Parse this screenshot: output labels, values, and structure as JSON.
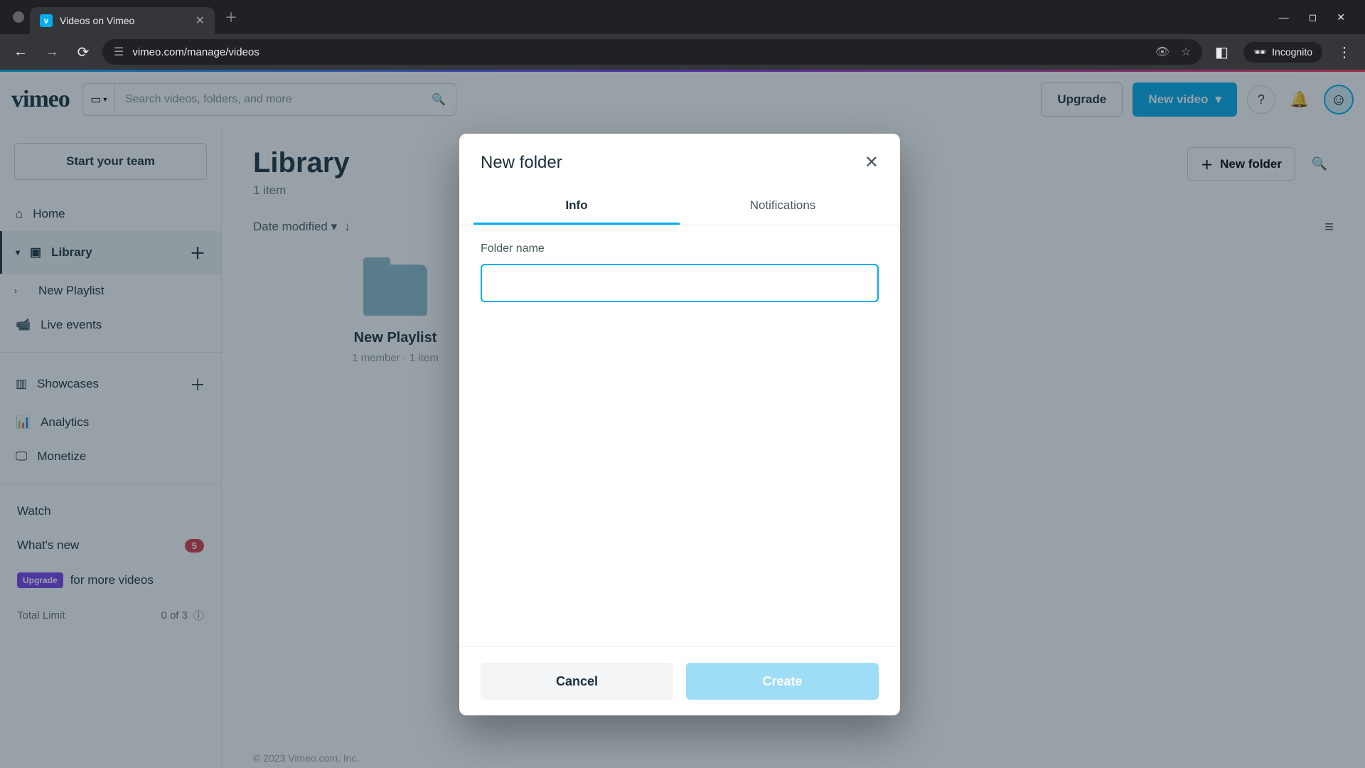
{
  "browser": {
    "tab_title": "Videos on Vimeo",
    "url": "vimeo.com/manage/videos",
    "incognito_label": "Incognito"
  },
  "topbar": {
    "logo": "vimeo",
    "search_placeholder": "Search videos, folders, and more",
    "upgrade": "Upgrade",
    "new_video": "New video"
  },
  "sidebar": {
    "start_team": "Start your team",
    "home": "Home",
    "library": "Library",
    "new_playlist": "New Playlist",
    "live_events": "Live events",
    "showcases": "Showcases",
    "analytics": "Analytics",
    "monetize": "Monetize",
    "watch": "Watch",
    "whats_new": "What's new",
    "whats_new_count": "5",
    "upgrade_chip": "Upgrade",
    "for_more": "for more videos",
    "total_limit_label": "Total Limit",
    "total_limit_value": "0 of 3"
  },
  "main": {
    "title": "Library",
    "count": "1 item",
    "new_folder_btn": "New folder",
    "sort_label": "Date modified",
    "folder_name": "New Playlist",
    "folder_meta": "1 member  ·  1 item",
    "footer": "© 2023 Vimeo.com, Inc."
  },
  "modal": {
    "title": "New folder",
    "tab_info": "Info",
    "tab_notifications": "Notifications",
    "field_label": "Folder name",
    "input_value": "",
    "cancel": "Cancel",
    "create": "Create"
  }
}
